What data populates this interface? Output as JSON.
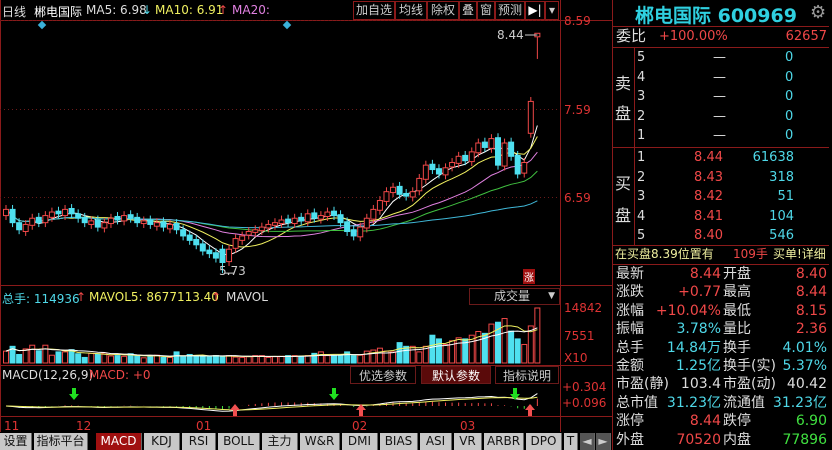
{
  "header": {
    "period": "日线",
    "name": "郴电国际",
    "ma5_label": "MA5: 6.98",
    "ma5_arrow": "↓",
    "ma10_label": "MA10: 6.91",
    "ma10_arrow": "↑",
    "ma20_label": "MA20:",
    "buttons": [
      "加自选",
      "均线",
      "除权",
      "叠",
      "窗",
      "预测",
      "▶|",
      "▾"
    ]
  },
  "price_axis": [
    "8.59",
    "7.59",
    "6.59"
  ],
  "markers": {
    "high": "8.44",
    "low": "5.73",
    "limit_up_badge": "涨"
  },
  "volume": {
    "total_label": "总手: 114936",
    "total_arrow": "↑",
    "mavol5_label": "MAVOL5: 8677113.40",
    "mavol5_arrow": "↑",
    "mavol_label": "MAVOL",
    "selector": "成交量",
    "axis": [
      "14842",
      "7551",
      "X10"
    ]
  },
  "macd": {
    "title": "MACD(12,26,9)",
    "value": "MACD: +0",
    "buttons": [
      "优选参数",
      "默认参数",
      "指标说明"
    ],
    "axis": [
      "+0.304",
      "+0.096"
    ]
  },
  "dates": [
    "11",
    "12",
    "01",
    "02",
    "03"
  ],
  "tabs": [
    "设置",
    "指标平台",
    "MACD",
    "KDJ",
    "RSI",
    "BOLL",
    "主力",
    "W&R",
    "DMI",
    "BIAS",
    "ASI",
    "VR",
    "ARBR",
    "DPO",
    "T"
  ],
  "quote": {
    "title": "郴电国际 600969",
    "weibi_label": "委比",
    "weibi_pct": "+100.00%",
    "weibi_val": "62657",
    "sell_label": [
      "卖",
      "盘"
    ],
    "buy_label": [
      "买",
      "盘"
    ],
    "sell": [
      {
        "n": "5",
        "p": "—",
        "v": "0"
      },
      {
        "n": "4",
        "p": "—",
        "v": "0"
      },
      {
        "n": "3",
        "p": "—",
        "v": "0"
      },
      {
        "n": "2",
        "p": "—",
        "v": "0"
      },
      {
        "n": "1",
        "p": "—",
        "v": "0"
      }
    ],
    "buy": [
      {
        "n": "1",
        "p": "8.44",
        "v": "61638"
      },
      {
        "n": "2",
        "p": "8.43",
        "v": "318"
      },
      {
        "n": "3",
        "p": "8.42",
        "v": "51"
      },
      {
        "n": "4",
        "p": "8.41",
        "v": "104"
      },
      {
        "n": "5",
        "p": "8.40",
        "v": "546"
      }
    ],
    "notice": "在买盘8.39位置有",
    "notice_qty": "109手",
    "notice_link": "买单!详细",
    "stats": [
      {
        "l1": "最新",
        "v1": "8.44",
        "c1": "red",
        "l2": "开盘",
        "v2": "8.40",
        "c2": "red"
      },
      {
        "l1": "涨跌",
        "v1": "+0.77",
        "c1": "red",
        "l2": "最高",
        "v2": "8.44",
        "c2": "red"
      },
      {
        "l1": "涨幅",
        "v1": "+10.04%",
        "c1": "red",
        "l2": "最低",
        "v2": "8.15",
        "c2": "red"
      },
      {
        "l1": "振幅",
        "v1": "3.78%",
        "c1": "cyan",
        "l2": "量比",
        "v2": "2.36",
        "c2": "red"
      },
      {
        "l1": "总手",
        "v1": "14.84万",
        "c1": "cyan",
        "l2": "换手",
        "v2": "4.01%",
        "c2": "cyan"
      },
      {
        "l1": "金额",
        "v1": "1.25亿",
        "c1": "cyan",
        "l2": "换手(实)",
        "v2": "5.37%",
        "c2": "cyan"
      },
      {
        "l1": "市盈(静)",
        "v1": "103.4",
        "c1": "white",
        "l2": "市盈(动)",
        "v2": "40.42",
        "c2": "white"
      },
      {
        "l1": "总市值",
        "v1": "31.23亿",
        "c1": "cyan",
        "l2": "流通值",
        "v2": "31.23亿",
        "c2": "cyan"
      },
      {
        "l1": "涨停",
        "v1": "8.44",
        "c1": "red",
        "l2": "跌停",
        "v2": "6.90",
        "c2": "green"
      },
      {
        "l1": "外盘",
        "v1": "70520",
        "c1": "red",
        "l2": "内盘",
        "v2": "77896",
        "c2": "green"
      }
    ]
  },
  "colors": {
    "up": "#f04848",
    "down": "#4fe0f0",
    "ma5": "#ffffff",
    "ma10": "#f0f060",
    "ma20": "#e080e0",
    "ma30": "#40c040",
    "ma60": "#40b8d8",
    "frame": "#8a1a1a"
  },
  "chart_data": {
    "type": "candlestick",
    "price_range": [
      5.6,
      8.59
    ],
    "opens": [
      6.38,
      6.45,
      6.3,
      6.2,
      6.27,
      6.36,
      6.3,
      6.36,
      6.43,
      6.38,
      6.46,
      6.4,
      6.36,
      6.28,
      6.33,
      6.24,
      6.29,
      6.37,
      6.32,
      6.39,
      6.36,
      6.29,
      6.33,
      6.26,
      6.31,
      6.23,
      6.29,
      6.22,
      6.16,
      6.11,
      6.06,
      5.99,
      5.96,
      6.0,
      5.86,
      6.01,
      6.1,
      6.16,
      6.19,
      6.21,
      6.24,
      6.27,
      6.29,
      6.34,
      6.29,
      6.36,
      6.31,
      6.41,
      6.34,
      6.37,
      6.43,
      6.39,
      6.31,
      6.22,
      6.14,
      6.24,
      6.34,
      6.44,
      6.54,
      6.64,
      6.71,
      6.63,
      6.59,
      6.66,
      6.79,
      6.96,
      6.91,
      6.84,
      6.93,
      6.97,
      7.06,
      6.99,
      7.09,
      7.21,
      7.14,
      7.26,
      6.94,
      7.21,
      7.06,
      6.86,
      7.31,
      8.4
    ],
    "closes": [
      6.45,
      6.3,
      6.22,
      6.28,
      6.35,
      6.3,
      6.38,
      6.42,
      6.4,
      6.45,
      6.4,
      6.35,
      6.3,
      6.32,
      6.25,
      6.3,
      6.35,
      6.33,
      6.38,
      6.35,
      6.3,
      6.32,
      6.28,
      6.3,
      6.25,
      6.28,
      6.22,
      6.15,
      6.1,
      6.05,
      5.98,
      5.95,
      5.9,
      5.85,
      6.0,
      6.12,
      6.15,
      6.2,
      6.22,
      6.25,
      6.28,
      6.3,
      6.33,
      6.3,
      6.35,
      6.32,
      6.4,
      6.35,
      6.38,
      6.42,
      6.38,
      6.3,
      6.2,
      6.15,
      6.25,
      6.35,
      6.45,
      6.55,
      6.65,
      6.7,
      6.62,
      6.6,
      6.65,
      6.8,
      6.95,
      6.9,
      6.85,
      6.92,
      6.98,
      7.05,
      7.0,
      7.1,
      7.2,
      7.15,
      7.25,
      6.95,
      7.2,
      7.05,
      6.85,
      6.98,
      7.67,
      8.44
    ],
    "low_index": 33,
    "low_value": 5.73,
    "last_low": 8.15,
    "last_high": 8.44,
    "volumes": [
      3200,
      4500,
      2300,
      3800,
      4800,
      3300,
      4800,
      2100,
      3000,
      3000,
      3600,
      2500,
      1500,
      2600,
      2500,
      2700,
      1900,
      2000,
      1800,
      2500,
      2000,
      1400,
      1700,
      2100,
      1500,
      1500,
      3000,
      1700,
      2300,
      2000,
      1800,
      1700,
      2000,
      1800,
      2000,
      1600,
      1500,
      1700,
      2000,
      2000,
      1500,
      1700,
      1800,
      2000,
      2000,
      1900,
      2000,
      2600,
      3000,
      2000,
      2000,
      2100,
      3000,
      2000,
      2100,
      3200,
      3500,
      4000,
      3200,
      3000,
      5500,
      4500,
      4500,
      3000,
      4500,
      7500,
      6500,
      5000,
      6000,
      6800,
      6500,
      7500,
      8500,
      8000,
      10500,
      11000,
      12000,
      8600,
      6500,
      5000,
      10000,
      14842
    ],
    "volume_max": 14842
  }
}
